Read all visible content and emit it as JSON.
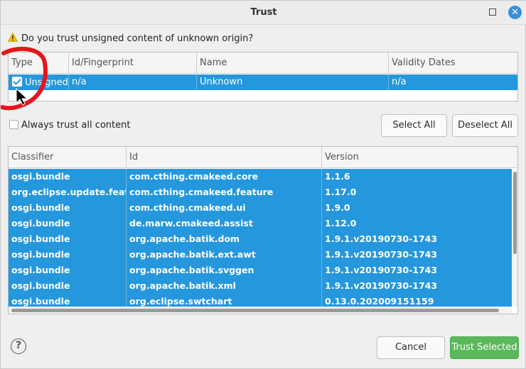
{
  "window": {
    "title": "Trust"
  },
  "question": "Do you trust unsigned content of unknown origin?",
  "signer_table": {
    "headers": [
      "Type",
      "Id/Fingerprint",
      "Name",
      "Validity Dates"
    ],
    "rows": [
      {
        "type": "Unsigned",
        "fingerprint": "n/a",
        "name": "Unknown",
        "validity": "n/a",
        "checked": true
      }
    ]
  },
  "always_trust_label": "Always trust all content",
  "buttons": {
    "select_all": "Select All",
    "deselect_all": "Deselect All",
    "cancel": "Cancel",
    "trust_selected": "Trust Selected"
  },
  "artifact_table": {
    "headers": [
      "Classifier",
      "Id",
      "Version"
    ],
    "rows": [
      {
        "classifier": "osgi.bundle",
        "id": "com.cthing.cmakeed.core",
        "version": "1.1.6"
      },
      {
        "classifier": "org.eclipse.update.feature",
        "id": "com.cthing.cmakeed.feature",
        "version": "1.17.0"
      },
      {
        "classifier": "osgi.bundle",
        "id": "com.cthing.cmakeed.ui",
        "version": "1.9.0"
      },
      {
        "classifier": "osgi.bundle",
        "id": "de.marw.cmakeed.assist",
        "version": "1.12.0"
      },
      {
        "classifier": "osgi.bundle",
        "id": "org.apache.batik.dom",
        "version": "1.9.1.v20190730-1743"
      },
      {
        "classifier": "osgi.bundle",
        "id": "org.apache.batik.ext.awt",
        "version": "1.9.1.v20190730-1743"
      },
      {
        "classifier": "osgi.bundle",
        "id": "org.apache.batik.svggen",
        "version": "1.9.1.v20190730-1743"
      },
      {
        "classifier": "osgi.bundle",
        "id": "org.apache.batik.xml",
        "version": "1.9.1.v20190730-1743"
      },
      {
        "classifier": "osgi.bundle",
        "id": "org.eclipse.swtchart",
        "version": "0.13.0.202009151159"
      }
    ]
  },
  "help_glyph": "?",
  "close_glyph": "✕",
  "colors": {
    "selection": "#2597dc",
    "accent_button": "#5cb85c",
    "annotation": "#e8141c"
  }
}
